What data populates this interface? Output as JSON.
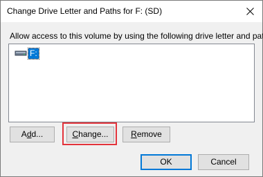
{
  "window": {
    "title": "Change Drive Letter and Paths for F: (SD)"
  },
  "instruction": "Allow access to this volume by using the following drive letter and paths:",
  "list": {
    "items": [
      {
        "label": "F:",
        "icon": "drive-icon",
        "selected": true
      }
    ]
  },
  "buttons": {
    "add": {
      "pre": "A",
      "key": "d",
      "post": "d..."
    },
    "change": {
      "pre": "",
      "key": "C",
      "post": "hange..."
    },
    "remove": {
      "pre": "",
      "key": "R",
      "post": "emove"
    },
    "ok": "OK",
    "cancel": "Cancel"
  },
  "colors": {
    "highlight": "#e3333b",
    "selection": "#0078d7",
    "default_button_border": "#0078d7"
  }
}
